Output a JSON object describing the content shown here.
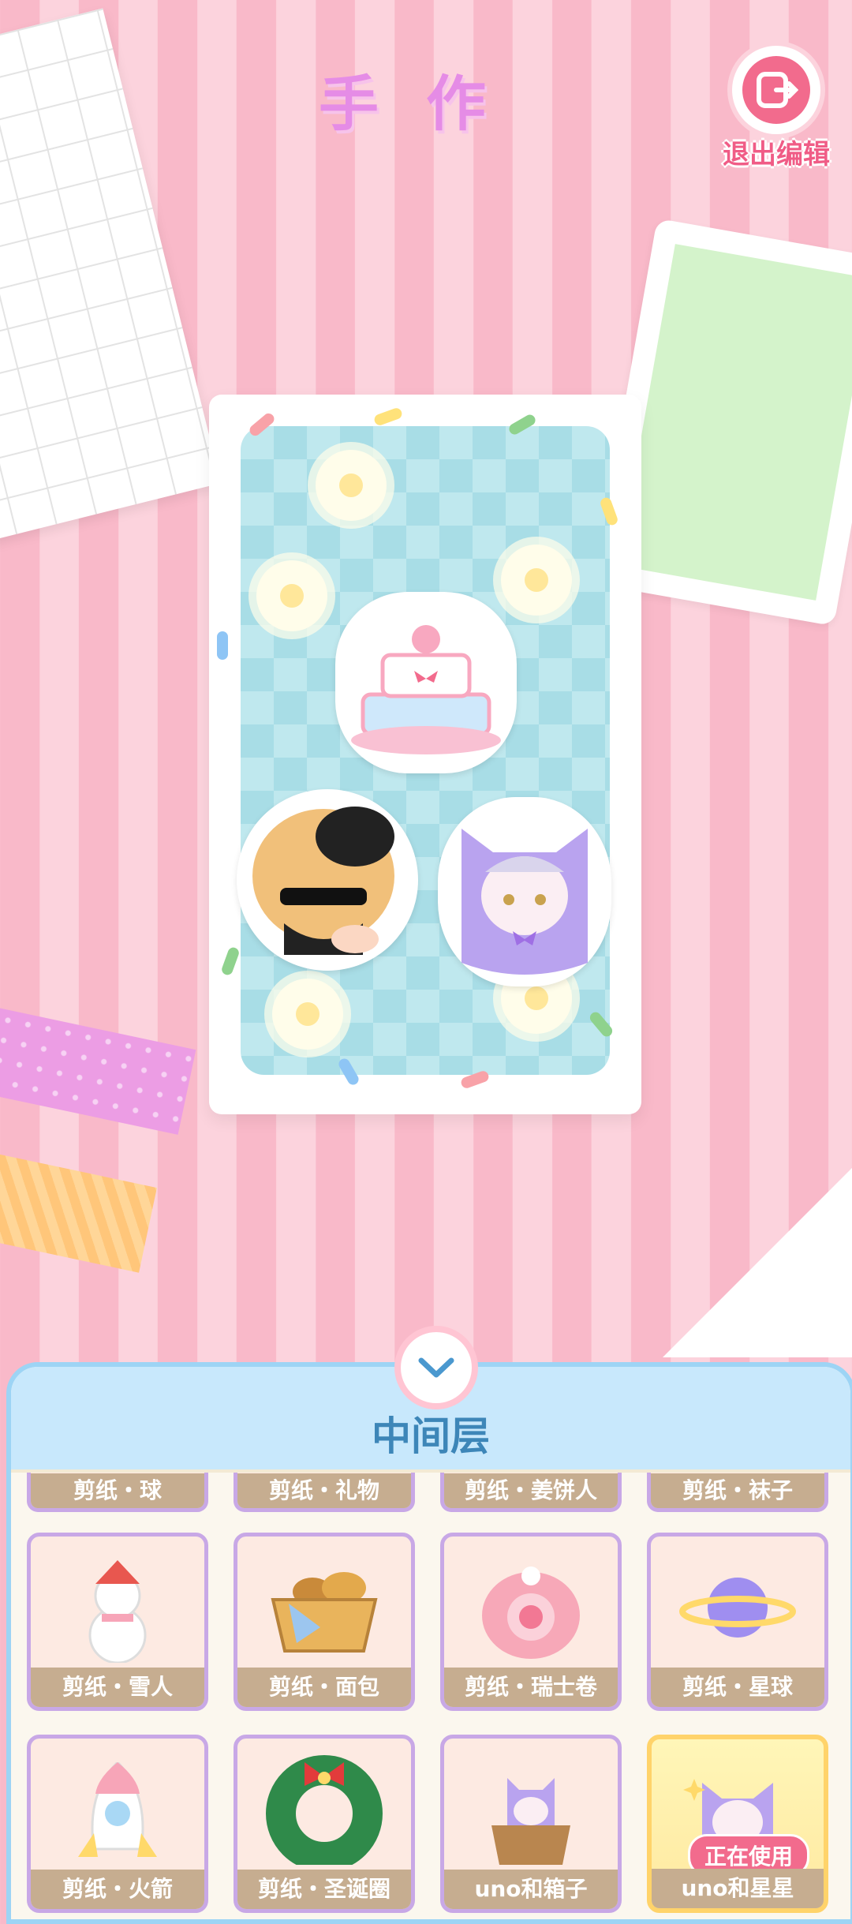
{
  "title": "手作",
  "exit_label": "退出编辑",
  "panel_title": "中间层",
  "items": [
    {
      "label": "剪纸・球",
      "state": ""
    },
    {
      "label": "剪纸・礼物",
      "state": ""
    },
    {
      "label": "剪纸・姜饼人",
      "state": ""
    },
    {
      "label": "剪纸・袜子",
      "state": ""
    },
    {
      "label": "剪纸・雪人",
      "state": ""
    },
    {
      "label": "剪纸・面包",
      "state": ""
    },
    {
      "label": "剪纸・瑞士卷",
      "state": ""
    },
    {
      "label": "剪纸・星球",
      "state": ""
    },
    {
      "label": "剪纸・火箭",
      "state": ""
    },
    {
      "label": "剪纸・圣诞圈",
      "state": ""
    },
    {
      "label": "uno和箱子",
      "state": ""
    },
    {
      "label": "uno和星星",
      "state": "正在使用"
    }
  ],
  "colors": {
    "accent_pink": "#f26b8d",
    "title_purple": "#e58ce6",
    "panel_blue": "#9dd4f5"
  }
}
